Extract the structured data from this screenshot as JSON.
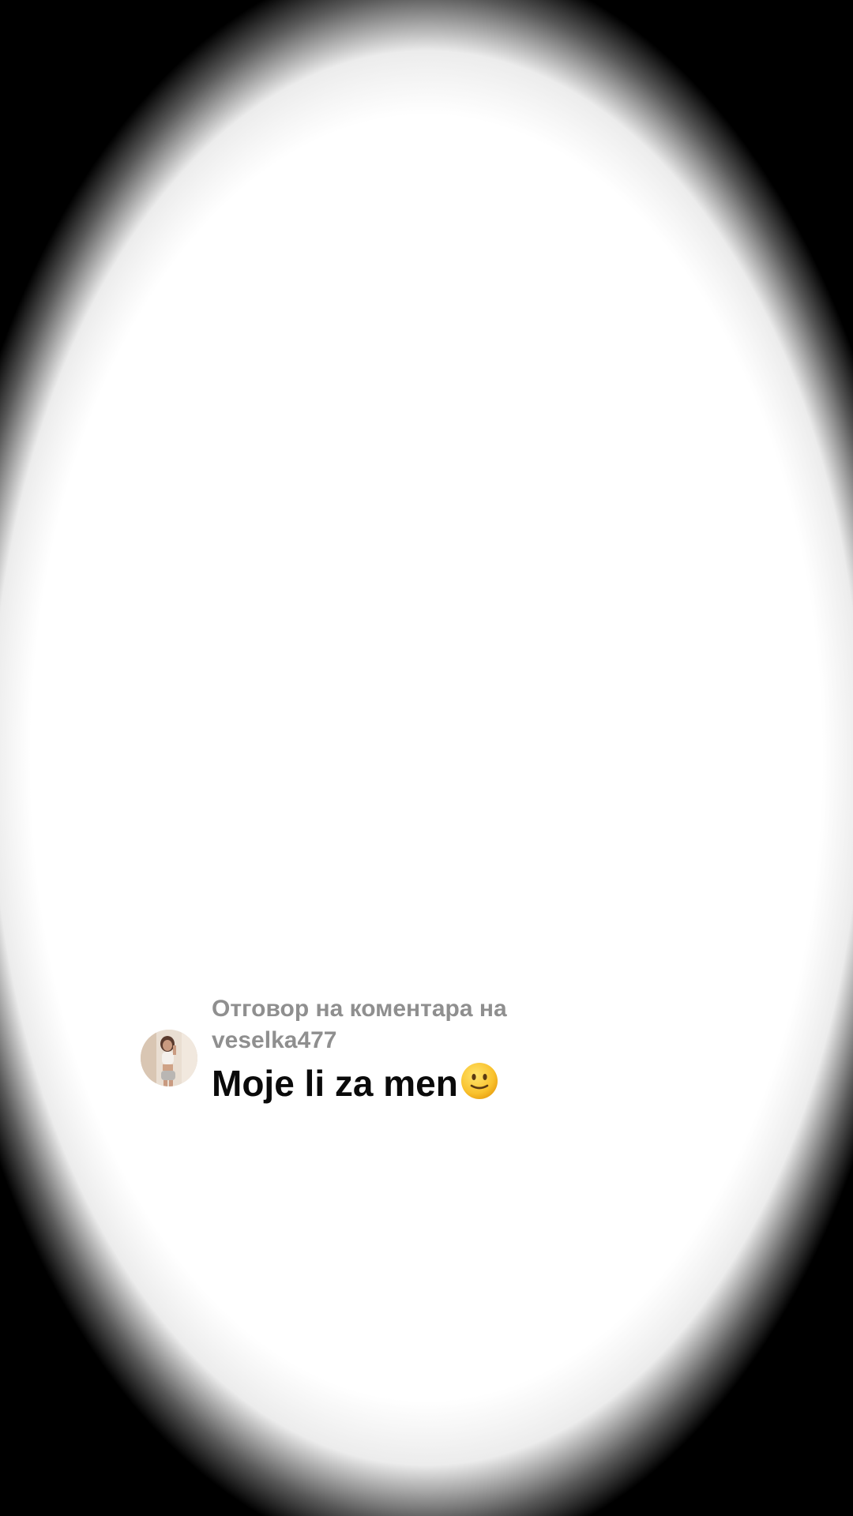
{
  "reply": {
    "label_line1": "Отговор на коментара на",
    "username": "veselka477",
    "comment": "Moje li za men",
    "emoji_icon": "slightly-smiling-face-icon"
  },
  "colors": {
    "label": "#8f8f8f",
    "comment": "#0a0a0a",
    "background": "#ffffff",
    "vignette": "#000000"
  }
}
